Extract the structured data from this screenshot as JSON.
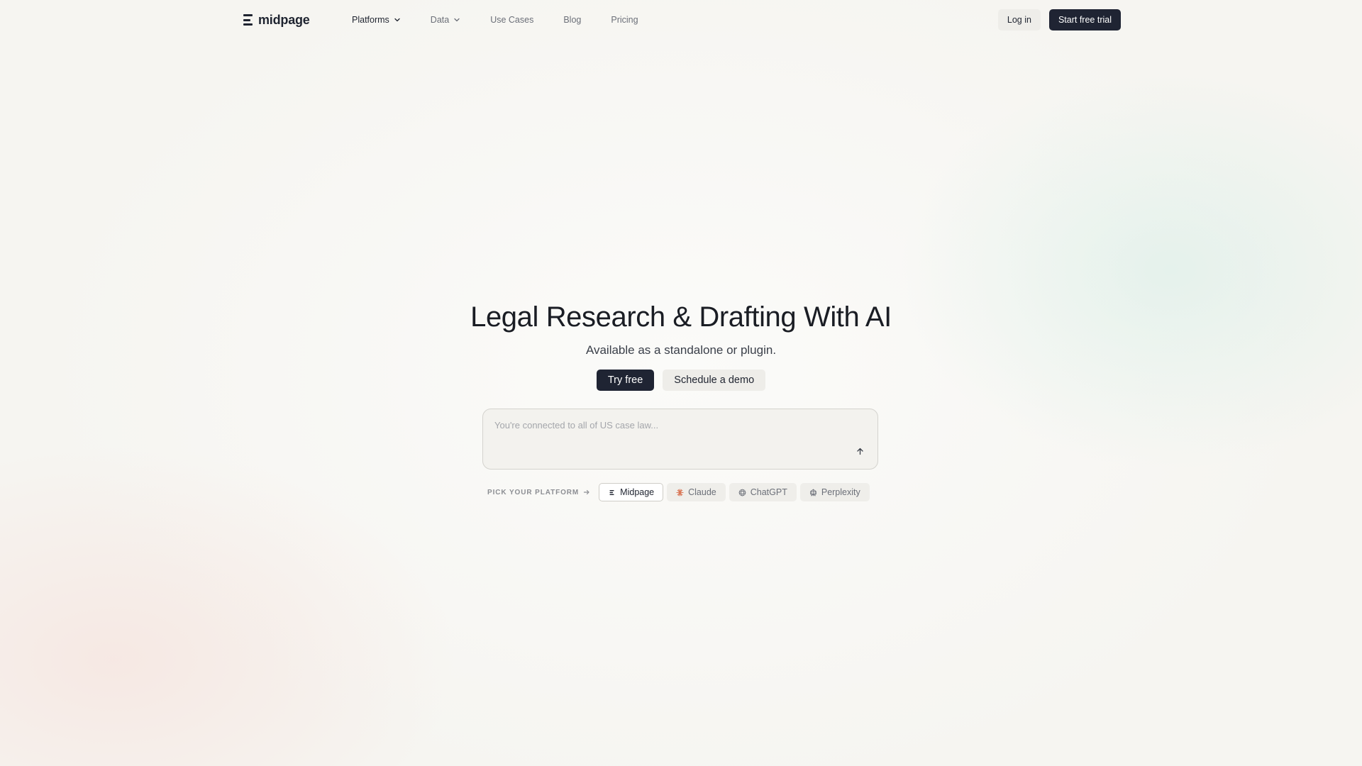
{
  "nav": {
    "logo_text": "midpage",
    "links": [
      {
        "label": "Platforms",
        "has_dropdown": true,
        "active": true
      },
      {
        "label": "Data",
        "has_dropdown": true,
        "active": false
      },
      {
        "label": "Use Cases",
        "has_dropdown": false,
        "active": false
      },
      {
        "label": "Blog",
        "has_dropdown": false,
        "active": false
      },
      {
        "label": "Pricing",
        "has_dropdown": false,
        "active": false
      }
    ],
    "login_label": "Log in",
    "trial_label": "Start free trial"
  },
  "hero": {
    "title": "Legal Research & Drafting With AI",
    "subtitle": "Available as a standalone or plugin.",
    "try_label": "Try free",
    "demo_label": "Schedule a demo"
  },
  "prompt": {
    "placeholder": "You're connected to all of US case law..."
  },
  "platforms": {
    "pick_label": "PICK YOUR PLATFORM",
    "options": [
      {
        "label": "Midpage",
        "icon": "midpage-logo-icon",
        "selected": true
      },
      {
        "label": "Claude",
        "icon": "claude-starburst-icon",
        "selected": false
      },
      {
        "label": "ChatGPT",
        "icon": "chatgpt-knot-icon",
        "selected": false
      },
      {
        "label": "Perplexity",
        "icon": "perplexity-icon",
        "selected": false
      }
    ]
  },
  "colors": {
    "primary_dark": "#1f2433",
    "secondary_bg": "#eeede9",
    "page_bg": "#f6f5f1",
    "muted_text": "#6b6f78",
    "claude_accent": "#d97757"
  }
}
